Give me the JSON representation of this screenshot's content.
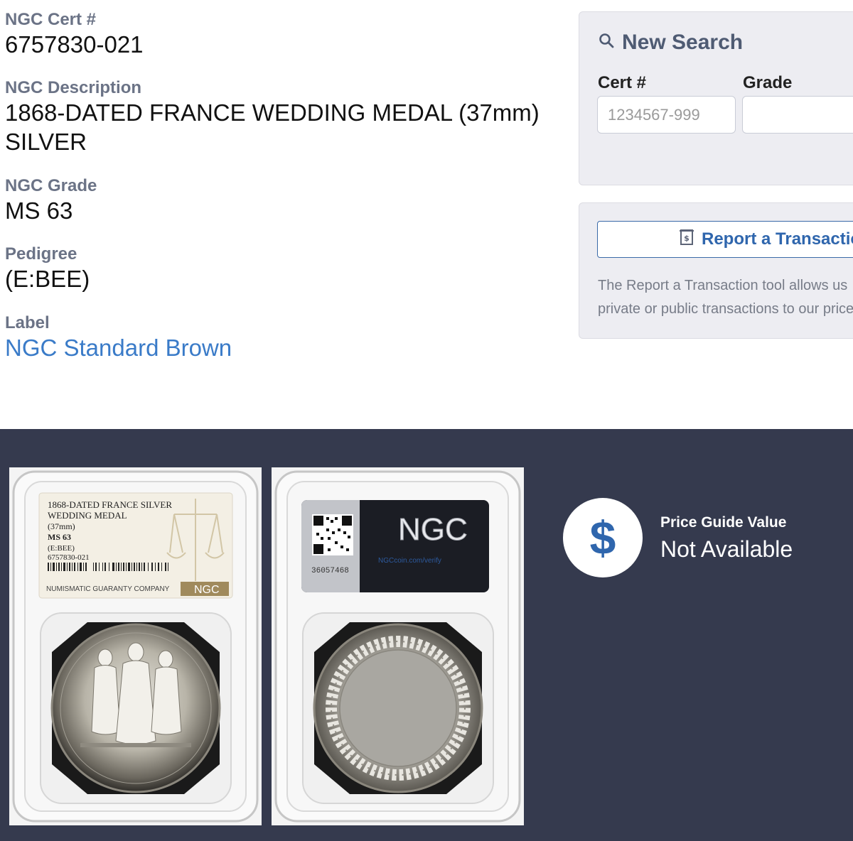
{
  "cert": {
    "label": "NGC Cert #",
    "value": "6757830-021"
  },
  "description": {
    "label": "NGC Description",
    "value": "1868-DATED FRANCE WEDDING MEDAL (37mm) SILVER"
  },
  "grade": {
    "label": "NGC Grade",
    "value": "MS 63"
  },
  "pedigree": {
    "label": "Pedigree",
    "value": "(E:BEE)"
  },
  "label_field": {
    "label": "Label",
    "value": "NGC Standard Brown"
  },
  "search": {
    "title": "New Search",
    "icon": "search-icon",
    "cert_label": "Cert #",
    "cert_placeholder": "1234567-999",
    "grade_label": "Grade",
    "grade_value": ""
  },
  "report": {
    "button_label": "Report a Transaction",
    "icon": "receipt-icon",
    "text_line1": "The Report a Transaction tool allows us",
    "text_line2": "private or public transactions to our price"
  },
  "price": {
    "icon": "$",
    "label": "Price Guide Value",
    "value": "Not Available"
  },
  "slab_label": {
    "line1": "1868-DATED FRANCE SILVER",
    "line2": "WEDDING MEDAL",
    "line3": "(37mm)",
    "grade": "MS 63",
    "pedigree": "(E:BEE)",
    "cert": "6757830-021",
    "company": "NUMISMATIC GUARANTY COMPANY",
    "brand": "NGC"
  },
  "slab_back": {
    "brand": "NGC",
    "verify": "NGCcoin.com/verify",
    "serial": "36057468"
  },
  "colors": {
    "label_gray": "#6b7386",
    "link_blue": "#3a7bc8",
    "dark_bg": "#353a4e",
    "card_bg": "#ededf2"
  }
}
